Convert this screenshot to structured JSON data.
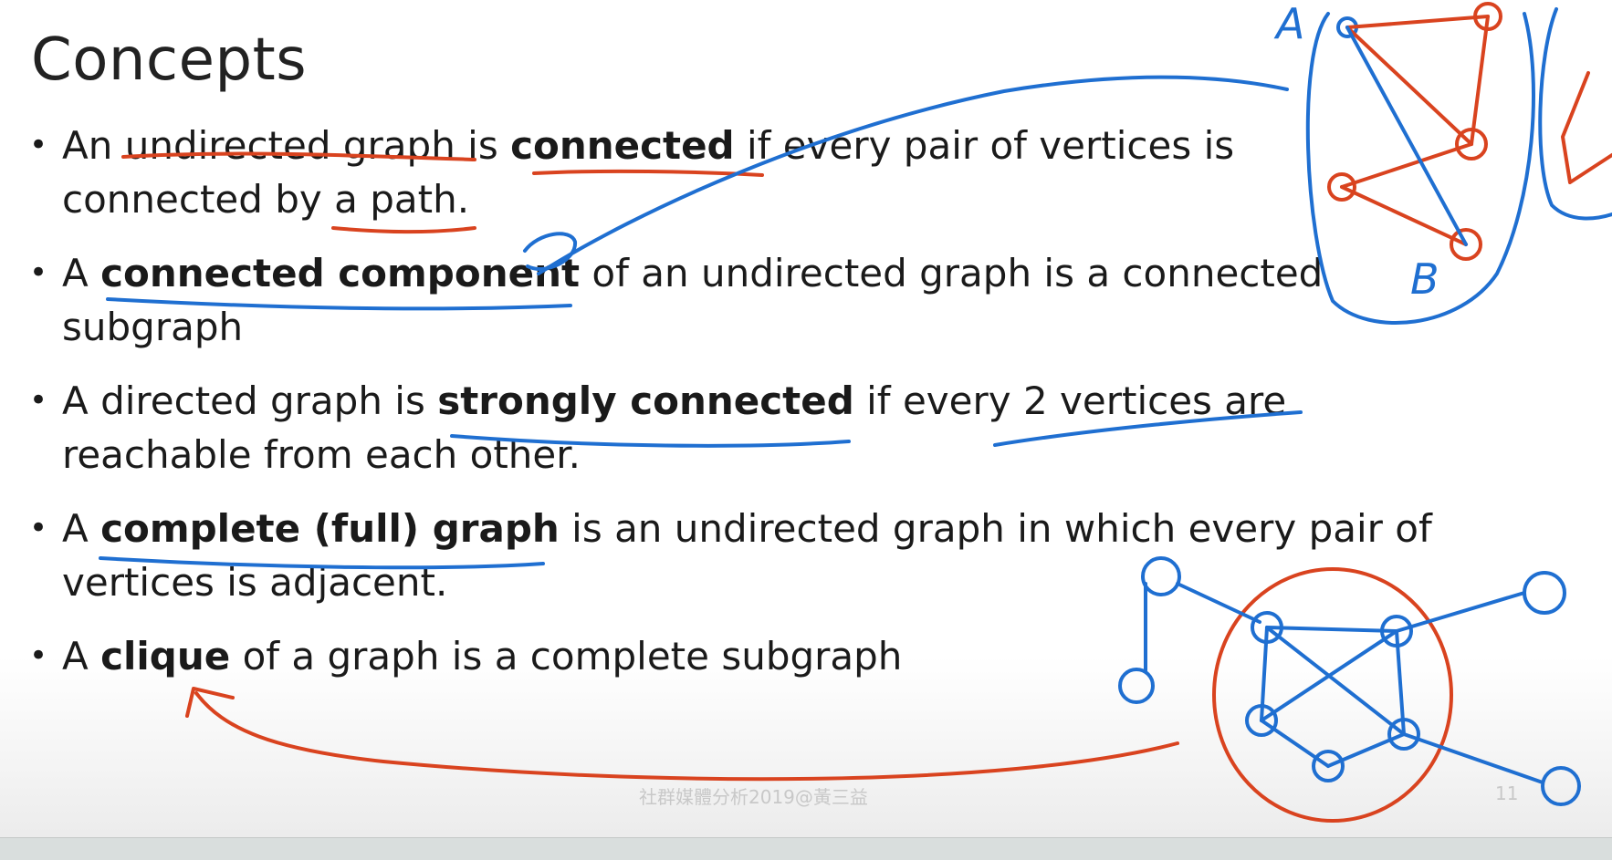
{
  "slide": {
    "title": "Concepts",
    "bullets": [
      {
        "segments": [
          {
            "text": "An undirected graph is ",
            "bold": false
          },
          {
            "text": "connected",
            "bold": true
          },
          {
            "text": " if every pair of vertices is connected by a path.",
            "bold": false
          }
        ]
      },
      {
        "segments": [
          {
            "text": "A ",
            "bold": false
          },
          {
            "text": "connected component",
            "bold": true
          },
          {
            "text": " of an undirected graph is a connected subgraph",
            "bold": false
          }
        ]
      },
      {
        "segments": [
          {
            "text": "A directed graph is ",
            "bold": false
          },
          {
            "text": "strongly connected",
            "bold": true
          },
          {
            "text": " if every 2 vertices are reachable from each other.",
            "bold": false
          }
        ]
      },
      {
        "segments": [
          {
            "text": "A ",
            "bold": false
          },
          {
            "text": "complete (full) graph",
            "bold": true
          },
          {
            "text": " is an undirected graph in which every pair of vertices is adjacent.",
            "bold": false
          }
        ]
      },
      {
        "segments": [
          {
            "text": "A ",
            "bold": false
          },
          {
            "text": "clique",
            "bold": true
          },
          {
            "text": " of a graph is a complete subgraph",
            "bold": false
          }
        ]
      }
    ],
    "bullet_symbol": "•",
    "footer": "社群媒體分析2019@黃三益",
    "page_number": "11"
  },
  "annotations": {
    "label_a": "A",
    "label_b": "B",
    "ink_colors": {
      "blue": "#1f6fd1",
      "red": "#d9431f"
    }
  }
}
